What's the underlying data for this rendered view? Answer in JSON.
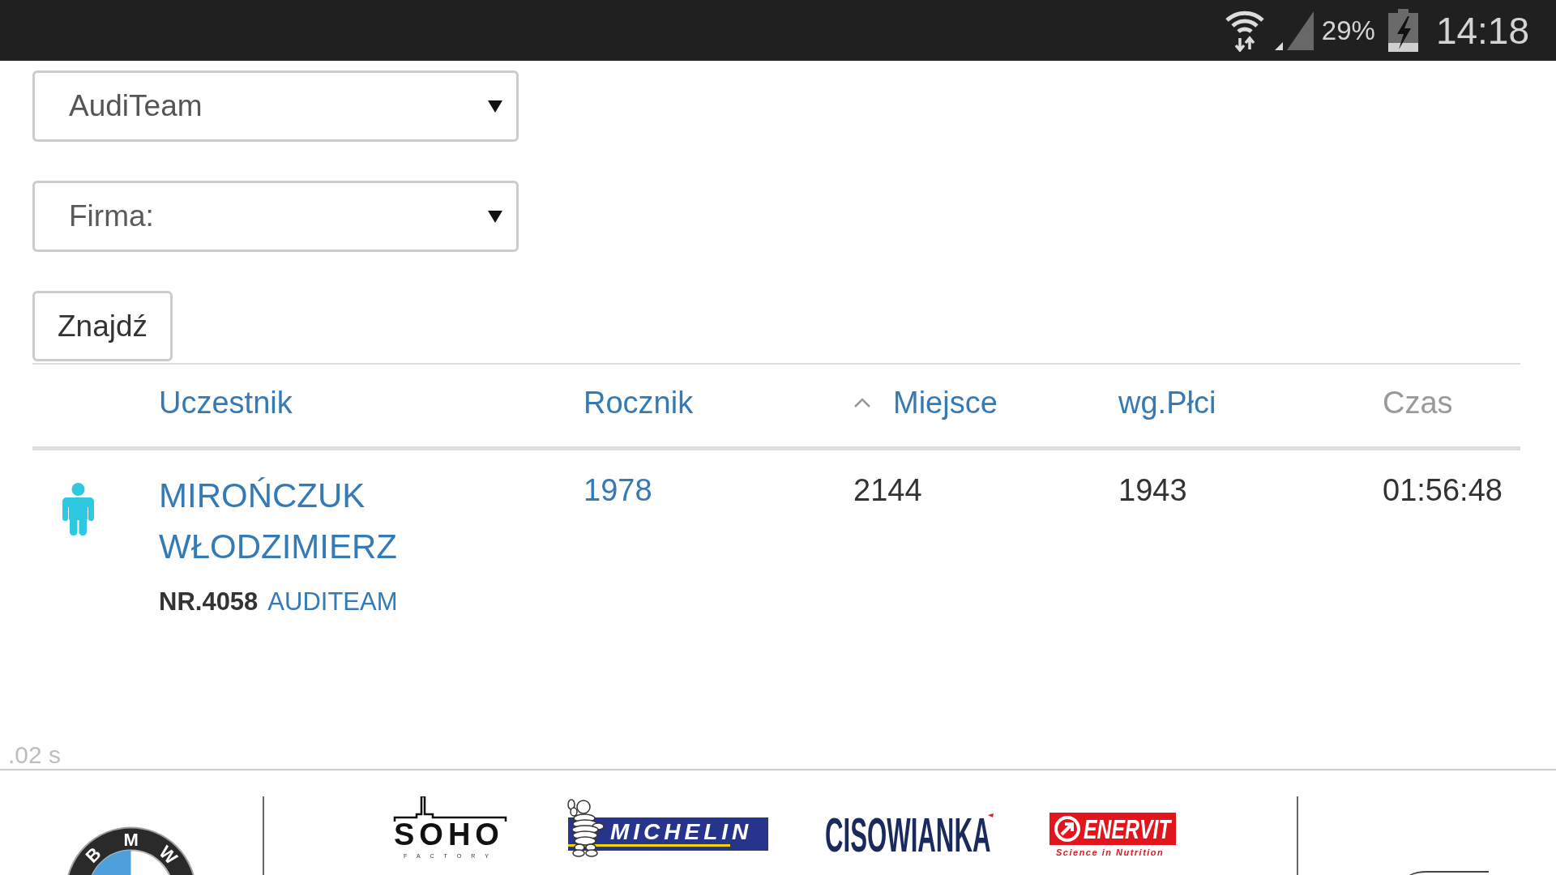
{
  "status_bar": {
    "battery_percent": "29%",
    "time": "14:18"
  },
  "filters": [
    {
      "value": "AudiTeam"
    },
    {
      "placeholder": "Firma:"
    }
  ],
  "search_button": {
    "label": "Znajdź"
  },
  "results": {
    "columns": [
      {
        "label": "Uczestnik",
        "sortable": true,
        "sorted": false
      },
      {
        "label": "Rocznik",
        "sortable": true,
        "sorted": false
      },
      {
        "label": "Miejsce",
        "sortable": true,
        "sorted": true
      },
      {
        "label": "wg.Płci",
        "sortable": true,
        "sorted": false
      },
      {
        "label": "Czas",
        "sortable": false,
        "sorted": false
      }
    ],
    "rows": [
      {
        "name": "MIROŃCZUK WŁODZIMIERZ",
        "bib": "NR.4058",
        "team": "AUDITEAM",
        "year": "1978",
        "place": "2144",
        "gender_place": "1943",
        "time": "01:56:48"
      }
    ]
  },
  "render_time": ".02 s",
  "sponsor_groups": [
    {
      "logos": [
        {
          "kind": "roundel",
          "text": "BMW"
        }
      ]
    },
    {
      "logos": [
        {
          "kind": "factory",
          "text": "SOHO",
          "subtitle": "FACTORY"
        },
        {
          "kind": "banner",
          "text": "MICHELIN"
        },
        {
          "kind": "wordmark",
          "text": "CISOWIANKA"
        },
        {
          "kind": "badge",
          "text": "ENERVIT",
          "subtitle": "Science in Nutrition"
        }
      ]
    },
    {
      "logos": [
        {
          "kind": "fragment"
        }
      ]
    }
  ]
}
